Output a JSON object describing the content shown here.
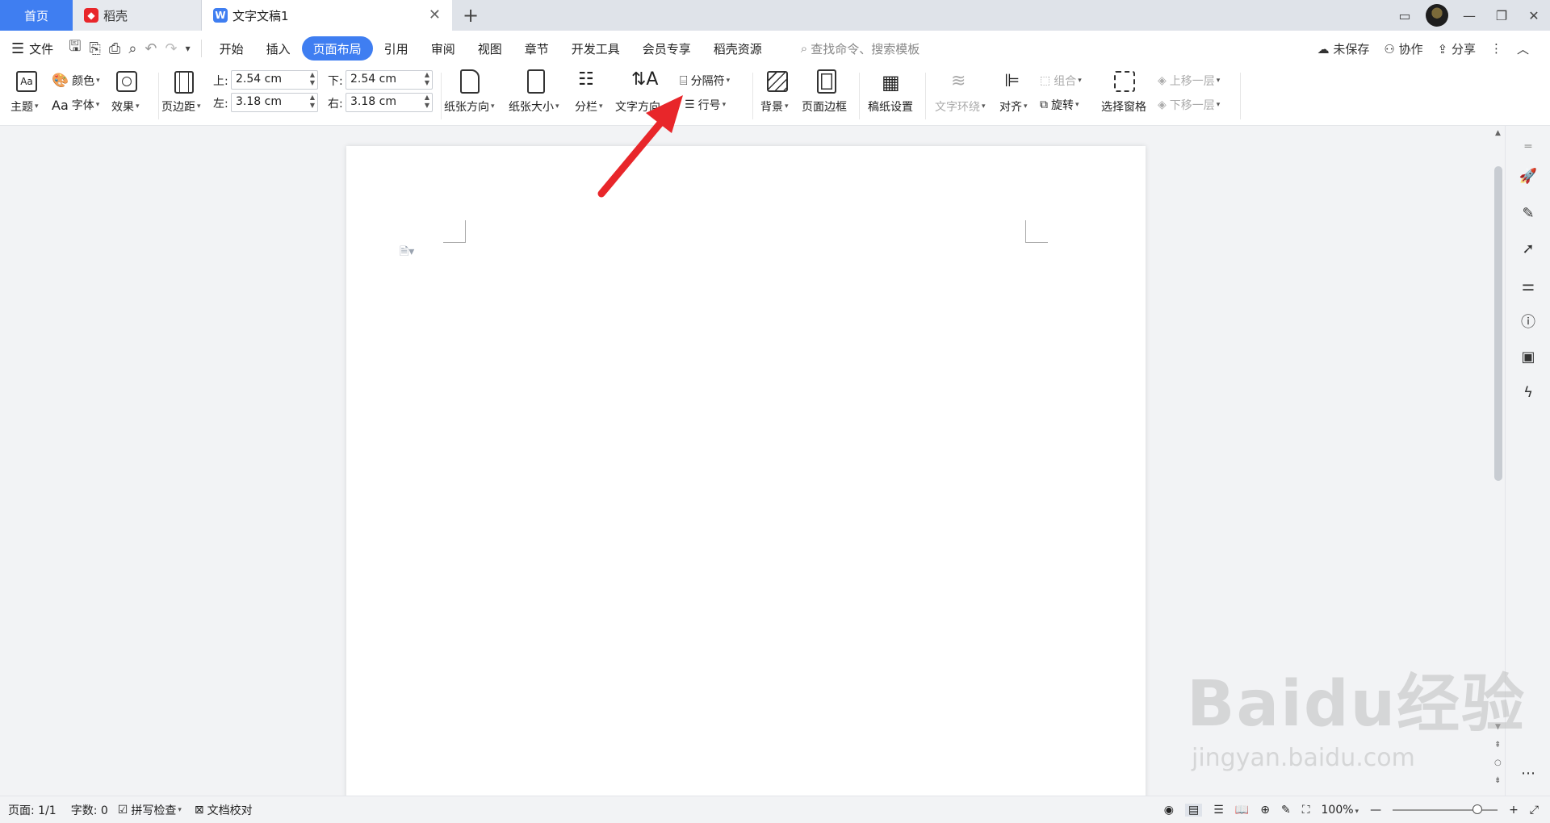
{
  "tabs": {
    "home": "首页",
    "daoke": "稻壳",
    "doc": "文字文稿1"
  },
  "menu": {
    "file": "文件",
    "items": [
      "开始",
      "插入",
      "页面布局",
      "引用",
      "审阅",
      "视图",
      "章节",
      "开发工具",
      "会员专享",
      "稻壳资源"
    ],
    "active_index": 2,
    "search": "查找命令、搜索模板",
    "unsaved": "未保存",
    "collab": "协作",
    "share": "分享"
  },
  "ribbon": {
    "theme": "主题",
    "color": "颜色",
    "font": "字体",
    "effect": "效果",
    "margins": "页边距",
    "top_label": "上:",
    "top_value": "2.54 cm",
    "bottom_label": "下:",
    "bottom_value": "2.54 cm",
    "left_label": "左:",
    "left_value": "3.18 cm",
    "right_label": "右:",
    "right_value": "3.18 cm",
    "orientation": "纸张方向",
    "size": "纸张大小",
    "columns": "分栏",
    "text_direction": "文字方向",
    "separator": "分隔符",
    "line_number": "行号",
    "background": "背景",
    "page_border": "页面边框",
    "manuscript": "稿纸设置",
    "wrap": "文字环绕",
    "align": "对齐",
    "rotate": "旋转",
    "group": "组合",
    "selection_pane": "选择窗格",
    "bring_forward": "上移一层",
    "send_backward": "下移一层"
  },
  "status": {
    "page": "页面: 1/1",
    "words": "字数: 0",
    "spell": "拼写检查",
    "proof": "文档校对",
    "zoom": "100%"
  },
  "watermark": {
    "brand": "Baidu经验",
    "url": "jingyan.baidu.com"
  },
  "colors": {
    "accent": "#3f7ef1",
    "arrow": "#e8262a"
  }
}
